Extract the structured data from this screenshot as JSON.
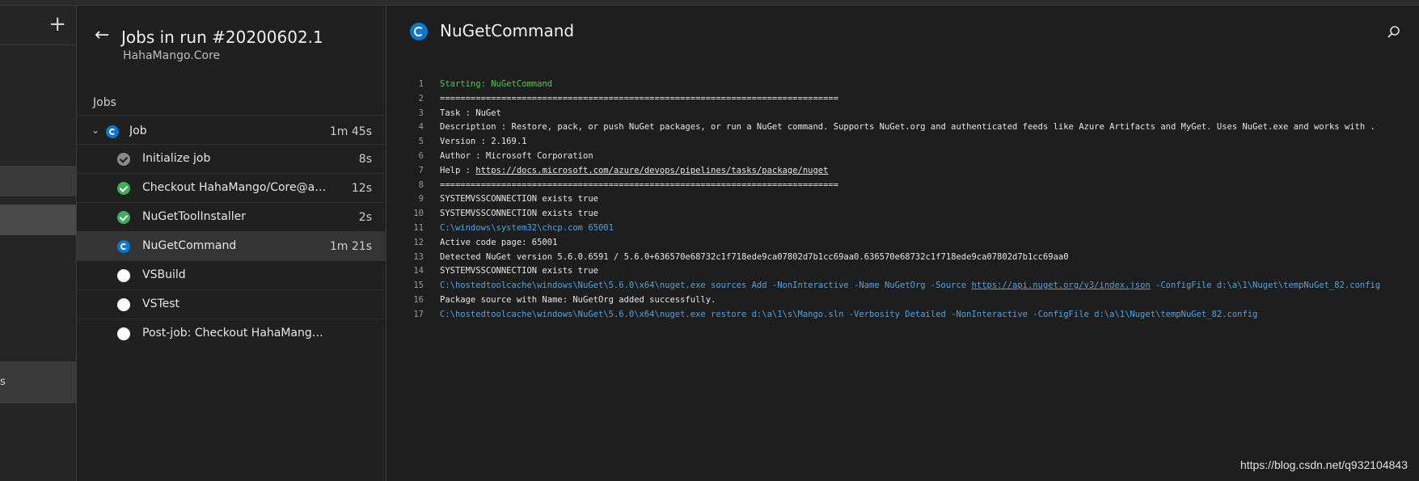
{
  "left_nav": {
    "add_label": "+",
    "truncated_item": "s"
  },
  "jobs_pane": {
    "title": "Jobs in run #20200602.1",
    "subtitle": "HahaMango.Core",
    "section_label": "Jobs",
    "job": {
      "label": "Job",
      "duration": "1m 45s",
      "status": "running"
    },
    "steps": [
      {
        "label": "Initialize job",
        "duration": "8s",
        "status": "skipped"
      },
      {
        "label": "Checkout HahaMango/Core@az...",
        "duration": "12s",
        "status": "success"
      },
      {
        "label": "NuGetToolInstaller",
        "duration": "2s",
        "status": "success"
      },
      {
        "label": "NuGetCommand",
        "duration": "1m 21s",
        "status": "running"
      },
      {
        "label": "VSBuild",
        "duration": "",
        "status": "pending"
      },
      {
        "label": "VSTest",
        "duration": "",
        "status": "pending"
      },
      {
        "label": "Post-job: Checkout HahaMango/Cor...",
        "duration": "",
        "status": "pending"
      }
    ]
  },
  "log_pane": {
    "title": "NuGetCommand",
    "lines": [
      {
        "n": "1",
        "text": "Starting: NuGetCommand",
        "style": "green"
      },
      {
        "n": "2",
        "text": "==============================================================================",
        "style": "plain"
      },
      {
        "n": "3",
        "text": "Task         : NuGet",
        "style": "plain"
      },
      {
        "n": "4",
        "text": "Description  : Restore, pack, or push NuGet packages, or run a NuGet command. Supports NuGet.org and authenticated feeds like Azure Artifacts and MyGet. Uses NuGet.exe and works with .",
        "style": "plain"
      },
      {
        "n": "5",
        "text": "Version      : 2.169.1",
        "style": "plain"
      },
      {
        "n": "6",
        "text": "Author       : Microsoft Corporation",
        "style": "plain"
      },
      {
        "n": "7",
        "text": "Help         : ",
        "link": "https://docs.microsoft.com/azure/devops/pipelines/tasks/package/nuget",
        "style": "plain"
      },
      {
        "n": "8",
        "text": "==============================================================================",
        "style": "plain"
      },
      {
        "n": "9",
        "text": "SYSTEMVSSCONNECTION exists true",
        "style": "plain"
      },
      {
        "n": "10",
        "text": "SYSTEMVSSCONNECTION exists true",
        "style": "plain"
      },
      {
        "n": "11",
        "text": "C:\\windows\\system32\\chcp.com 65001",
        "style": "blue"
      },
      {
        "n": "12",
        "text": "Active code page: 65001",
        "style": "plain"
      },
      {
        "n": "13",
        "text": "Detected NuGet version 5.6.0.6591 / 5.6.0+636570e68732c1f718ede9ca07802d7b1cc69aa0.636570e68732c1f718ede9ca07802d7b1cc69aa0",
        "style": "plain"
      },
      {
        "n": "14",
        "text": "SYSTEMVSSCONNECTION exists true",
        "style": "plain"
      },
      {
        "n": "15",
        "text": "C:\\hostedtoolcache\\windows\\NuGet\\5.6.0\\x64\\nuget.exe sources Add -NonInteractive -Name NuGetOrg -Source ",
        "link": "https://api.nuget.org/v3/index.json",
        "after": " -ConfigFile d:\\a\\1\\Nuget\\tempNuGet_82.config",
        "style": "blue"
      },
      {
        "n": "16",
        "text": "Package source with Name: NuGetOrg added successfully.",
        "style": "plain"
      },
      {
        "n": "17",
        "text": "C:\\hostedtoolcache\\windows\\NuGet\\5.6.0\\x64\\nuget.exe restore d:\\a\\1\\s\\Mango.sln -Verbosity Detailed -NonInteractive -ConfigFile d:\\a\\1\\Nuget\\tempNuGet_82.config",
        "style": "blue"
      }
    ]
  },
  "watermark": "https://blog.csdn.net/q932104843",
  "colors": {
    "running": "#0078d4",
    "success": "#3fae58",
    "skipped": "#8a8a8a",
    "pending": "#ffffff",
    "log_green": "#4ec95b",
    "log_blue": "#4fa3e0"
  }
}
